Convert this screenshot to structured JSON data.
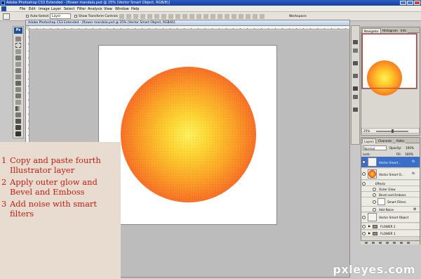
{
  "window": {
    "title": "Adobe Photoshop CS3 Extended - [flower mandala.psd @ 25% (Vector Smart Object, RGB/8)]"
  },
  "menu": [
    "File",
    "Edit",
    "Image",
    "Layer",
    "Select",
    "Filter",
    "Analysis",
    "View",
    "Window",
    "Help"
  ],
  "options": {
    "auto_select_label": "Auto-Select:",
    "auto_select_value": "Layer",
    "show_transform_label": "Show Transform Controls",
    "workspace_label": "Workspace"
  },
  "toolbar": {
    "logo": "Ps"
  },
  "navigator": {
    "tabs": [
      "Navigator",
      "Histogram",
      "Info"
    ],
    "zoom": "25%"
  },
  "layers": {
    "tabs": [
      "Layers",
      "Channels",
      "Paths"
    ],
    "blend_mode": "Normal",
    "opacity_label": "Opacity:",
    "opacity_value": "100%",
    "lock_label": "Lock:",
    "fill_label": "Fill:",
    "fill_value": "100%",
    "rows": {
      "layer1": "Vector Smart...",
      "layer2": "Vector Smart O...",
      "effects": "Effects",
      "outer_glow": "Outer Glow",
      "bevel": "Bevel and Emboss",
      "smart_filters": "Smart Filters",
      "add_noise": "Add Noise",
      "layer3": "Vector Smart Object",
      "group1": "FLOWER 2",
      "group2": "FLOWER 1"
    }
  },
  "instructions": {
    "steps": [
      {
        "num": "1",
        "text": "Copy and paste fourth Illustrator layer"
      },
      {
        "num": "2",
        "text": "Apply outer glow and Bevel and Emboss"
      },
      {
        "num": "3",
        "text": "Add noise with smart filters"
      }
    ]
  },
  "watermark": "pxleyes.com",
  "colors": {
    "circle_center": "#fff25a",
    "circle_edge": "#dc3220",
    "instruction_text": "#c61d12",
    "instruction_bg": "#e8dcd0"
  }
}
